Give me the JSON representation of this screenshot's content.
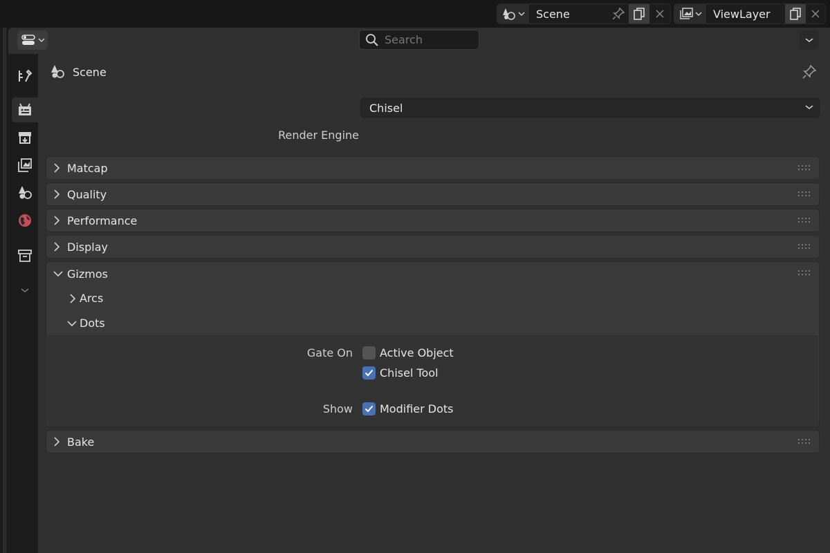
{
  "topbar": {
    "scene_name": "Scene",
    "viewlayer_name": "ViewLayer"
  },
  "header": {
    "search_placeholder": "Search"
  },
  "context": {
    "title": "Scene"
  },
  "render_engine": {
    "label": "Render Engine",
    "value": "Chisel"
  },
  "panels": {
    "matcap": "Matcap",
    "quality": "Quality",
    "performance": "Performance",
    "display": "Display",
    "gizmos": "Gizmos",
    "bake": "Bake"
  },
  "gizmos": {
    "arcs": "Arcs",
    "dots": "Dots",
    "gate_on_label": "Gate On",
    "active_object": "Active Object",
    "chisel_tool": "Chisel Tool",
    "show_label": "Show",
    "modifier_dots": "Modifier Dots",
    "active_object_checked": false,
    "chisel_tool_checked": true,
    "modifier_dots_checked": true
  },
  "colors": {
    "accent": "#4772b3",
    "panel": "#3a3a3a",
    "background": "#303030"
  }
}
